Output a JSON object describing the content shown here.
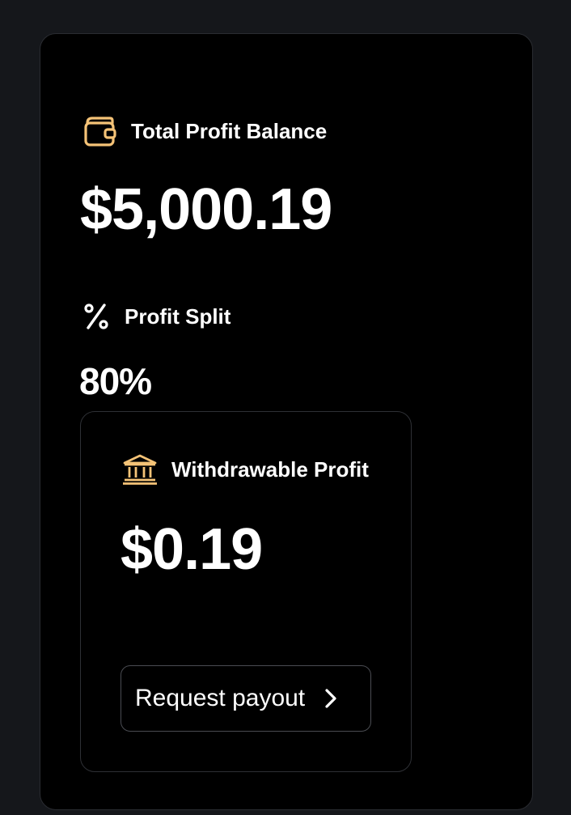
{
  "total_profit": {
    "label": "Total Profit Balance",
    "value": "$5,000.19",
    "icon": "wallet-icon"
  },
  "profit_split": {
    "label": "Profit Split",
    "value": "80%",
    "icon": "percent-icon"
  },
  "withdrawable": {
    "label": "Withdrawable Profit",
    "value": "$0.19",
    "icon": "bank-icon"
  },
  "payout_button": {
    "label": "Request payout",
    "icon": "chevron-right-icon"
  },
  "colors": {
    "page_bg": "#15171b",
    "card_bg": "#000000",
    "accent_icon": "#f5c377",
    "text": "#ffffff"
  }
}
